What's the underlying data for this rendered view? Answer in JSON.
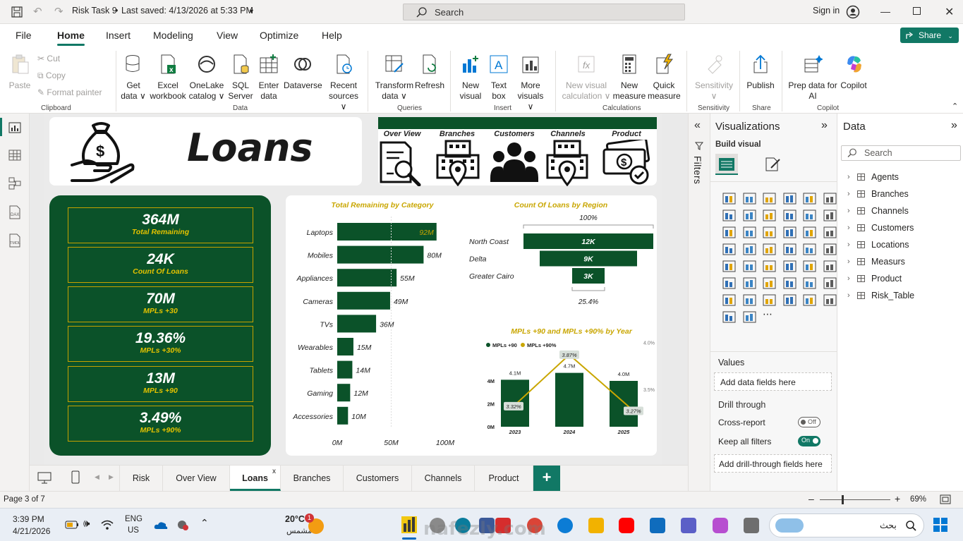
{
  "titlebar": {
    "doc_title": "Risk Task 9",
    "saved": "Last saved: 4/13/2026 at 5:33 PM",
    "search_placeholder": "Search",
    "sign_in": "Sign in"
  },
  "menu": {
    "items": [
      "File",
      "Home",
      "Insert",
      "Modeling",
      "View",
      "Optimize",
      "Help"
    ],
    "share": "Share"
  },
  "ribbon": {
    "paste": "Paste",
    "cut": "Cut",
    "copy": "Copy",
    "format_painter": "Format painter",
    "get_data": [
      "Get",
      "data ∨"
    ],
    "excel": [
      "Excel",
      "workbook"
    ],
    "onelake": [
      "OneLake",
      "catalog ∨"
    ],
    "sql": [
      "SQL",
      "Server"
    ],
    "enter_data": [
      "Enter",
      "data"
    ],
    "dataverse": "Dataverse",
    "recent": [
      "Recent",
      "sources ∨"
    ],
    "transform": [
      "Transform",
      "data ∨"
    ],
    "refresh": "Refresh",
    "new_visual": [
      "New",
      "visual"
    ],
    "text_box": [
      "Text",
      "box"
    ],
    "more_visuals": [
      "More",
      "visuals ∨"
    ],
    "new_visual_calc": [
      "New visual",
      "calculation ∨"
    ],
    "new_measure": [
      "New",
      "measure"
    ],
    "quick_measure": [
      "Quick",
      "measure"
    ],
    "sensitivity": [
      "Sensitivity",
      "∨"
    ],
    "publish": "Publish",
    "prep_ai": [
      "Prep data for",
      "AI"
    ],
    "copilot": "Copilot",
    "groups": [
      "Clipboard",
      "Data",
      "Queries",
      "Insert",
      "Calculations",
      "Sensitivity",
      "Share",
      "Copilot"
    ]
  },
  "report": {
    "title": "Loans",
    "nav_labels": [
      "Over View",
      "Branches",
      "Customers",
      "Channels",
      "Product"
    ],
    "kpis": [
      {
        "value": "364M",
        "label": "Total Remaining"
      },
      {
        "value": "24K",
        "label": "Count Of Loans"
      },
      {
        "value": "70M",
        "label": "MPLs +30"
      },
      {
        "value": "19.36%",
        "label": "MPLs +30%"
      },
      {
        "value": "13M",
        "label": "MPLs +90"
      },
      {
        "value": "3.49%",
        "label": "MPLs +90%"
      }
    ],
    "colors": {
      "dark_green": "#0b5229",
      "gold": "#c9a600",
      "bg": "#ebebeb"
    }
  },
  "chart_data": [
    {
      "type": "bar",
      "title": "Total Remaining by Category",
      "orientation": "horizontal",
      "categories": [
        "Laptops",
        "Mobiles",
        "Appliances",
        "Cameras",
        "TVs",
        "Wearables",
        "Tablets",
        "Gaming",
        "Accessories"
      ],
      "values": [
        92,
        80,
        55,
        49,
        36,
        15,
        14,
        12,
        10
      ],
      "value_labels": [
        "92M",
        "80M",
        "55M",
        "49M",
        "36M",
        "15M",
        "14M",
        "12M",
        "10M"
      ],
      "x_ticks": [
        "0M",
        "50M",
        "100M"
      ],
      "xlim": [
        0,
        100
      ]
    },
    {
      "type": "funnel",
      "title": "Count Of Loans by Region",
      "categories": [
        "North Coast",
        "Delta",
        "Greater Cairo"
      ],
      "values": [
        12,
        9,
        3
      ],
      "value_labels": [
        "12K",
        "9K",
        "3K"
      ],
      "top_pct": "100%",
      "bottom_pct": "25.4%"
    },
    {
      "type": "bar",
      "title": "MPLs +90 and MPLs +90% by Year",
      "categories": [
        "2023",
        "2024",
        "2025"
      ],
      "series": [
        {
          "name": "MPLs +90",
          "values": [
            4.1,
            4.7,
            4.0
          ],
          "labels": [
            "4.1M",
            "4.7M",
            "4.0M"
          ]
        },
        {
          "name": "MPLs +90%",
          "type": "line",
          "values": [
            3.32,
            3.87,
            3.27
          ],
          "labels": [
            "3.32%",
            "3.87%",
            "3.27%"
          ]
        }
      ],
      "y_ticks": [
        "0M",
        "2M",
        "4M"
      ],
      "ylim": [
        0,
        5
      ],
      "y2_ticks": [
        "3.5%",
        "4.0%"
      ],
      "y2lim": [
        3.1,
        4.05
      ]
    }
  ],
  "tabs": [
    "Risk",
    "Over View",
    "Loans",
    "Branches",
    "Customers",
    "Channels",
    "Product"
  ],
  "active_tab": "Loans",
  "filters_label": "Filters",
  "viz_pane": {
    "title": "Visualizations",
    "build_visual": "Build visual",
    "values": "Values",
    "add_data": "Add data fields here",
    "drill_through": "Drill through",
    "cross_report": "Cross-report",
    "cross_report_state": "Off",
    "keep_all_filters": "Keep all filters",
    "keep_state": "On",
    "add_drill": "Add drill-through fields here"
  },
  "data_pane": {
    "title": "Data",
    "search_placeholder": "Search",
    "tables": [
      "Agents",
      "Branches",
      "Channels",
      "Customers",
      "Locations",
      "Measurs",
      "Product",
      "Risk_Table"
    ]
  },
  "status": {
    "page": "Page 3 of 7",
    "zoom": "69%"
  },
  "taskbar": {
    "time": "3:39 PM",
    "date": "4/21/2026",
    "lang1": "ENG",
    "lang2": "US",
    "temp": "20°C",
    "weather": "مشمس",
    "search": "بحث",
    "badge": "1",
    "watermark": "nafezly.com"
  }
}
